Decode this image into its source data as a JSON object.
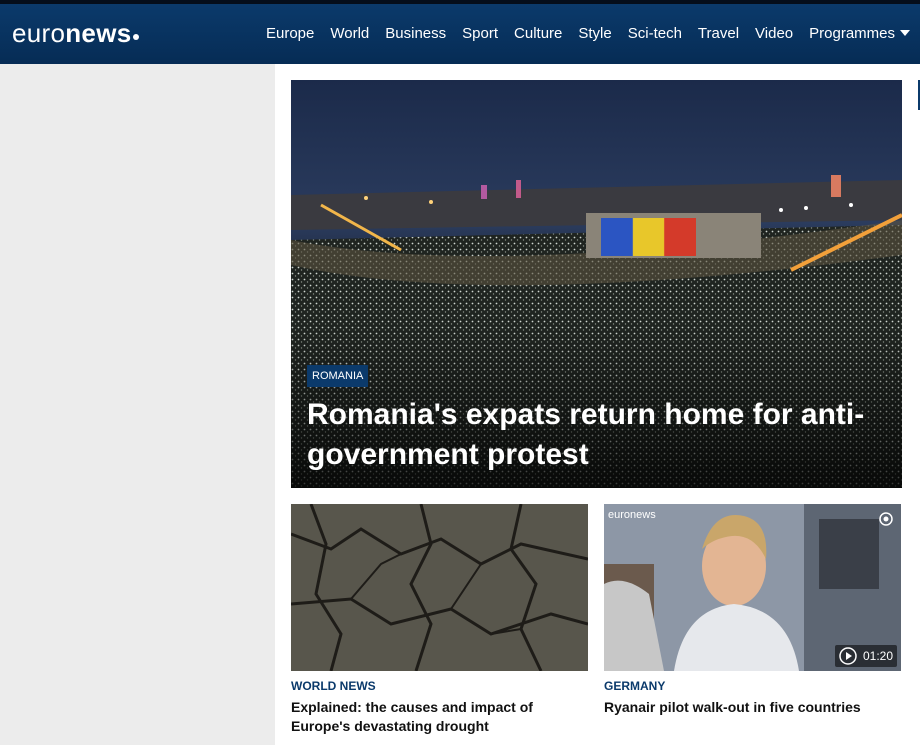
{
  "header": {
    "logo_light": "euro",
    "logo_bold": "news",
    "nav": [
      "Europe",
      "World",
      "Business",
      "Sport",
      "Culture",
      "Style",
      "Sci-tech",
      "Travel",
      "Video"
    ],
    "programmes": "Programmes"
  },
  "hero": {
    "category": "ROMANIA",
    "title": "Romania's expats return home for anti-government protest"
  },
  "cards": [
    {
      "category": "WORLD NEWS",
      "title": "Explained: the causes and impact of Europe's devastating drought"
    },
    {
      "category": "GERMANY",
      "title": "Ryanair pilot walk-out in five countries",
      "duration": "01:20",
      "watermark": "euronews"
    }
  ],
  "colors": {
    "brand": "#0b3a6b",
    "sidebar": "#ececec"
  }
}
